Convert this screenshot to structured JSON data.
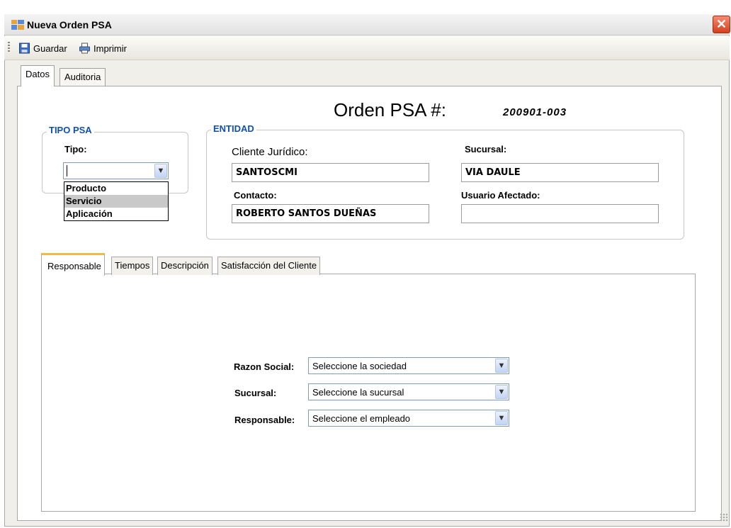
{
  "window": {
    "title": "Nueva Orden PSA",
    "close_glyph": "✕"
  },
  "toolbar": {
    "save_label": "Guardar",
    "print_label": "Imprimir"
  },
  "main_tabs": [
    {
      "label": "Datos",
      "active": true
    },
    {
      "label": "Auditoria",
      "active": false
    }
  ],
  "orden": {
    "title": "Orden PSA #:",
    "number": "200901-003"
  },
  "tipo_psa": {
    "legend": "TIPO PSA",
    "tipo_label": "Tipo:",
    "tipo_value": "",
    "options": [
      "Producto",
      "Servicio",
      "Aplicación"
    ],
    "highlighted_option": "Servicio"
  },
  "entidad": {
    "legend": "ENTIDAD",
    "cliente_label": "Cliente Jurídico:",
    "cliente_value": "SANTOSCMI",
    "sucursal_label": "Sucursal:",
    "sucursal_value": "VIA DAULE",
    "contacto_label": "Contacto:",
    "contacto_value": "ROBERTO  SANTOS DUEÑAS",
    "usuario_label": "Usuario Afectado:",
    "usuario_value": ""
  },
  "inner_tabs": [
    {
      "label": "Responsable",
      "active": true
    },
    {
      "label": "Tiempos",
      "active": false
    },
    {
      "label": "Descripción",
      "active": false
    },
    {
      "label": "Satisfacción del Cliente",
      "active": false
    }
  ],
  "responsable": {
    "razon_label": "Razon Social:",
    "razon_value": "Seleccione la sociedad",
    "sucursal_label": "Sucursal:",
    "sucursal_value": "Seleccione la sucursal",
    "responsable_label": "Responsable:",
    "responsable_value": "Seleccione el empleado"
  },
  "icons": {
    "app": "app-form-icon",
    "save": "floppy-disk-icon",
    "print": "printer-icon",
    "dropdown": "chevron-down-icon",
    "close": "close-icon"
  },
  "colors": {
    "legend": "#1050a8",
    "close_button": "#d53f1d",
    "active_tab_accent": "#f5b849"
  }
}
